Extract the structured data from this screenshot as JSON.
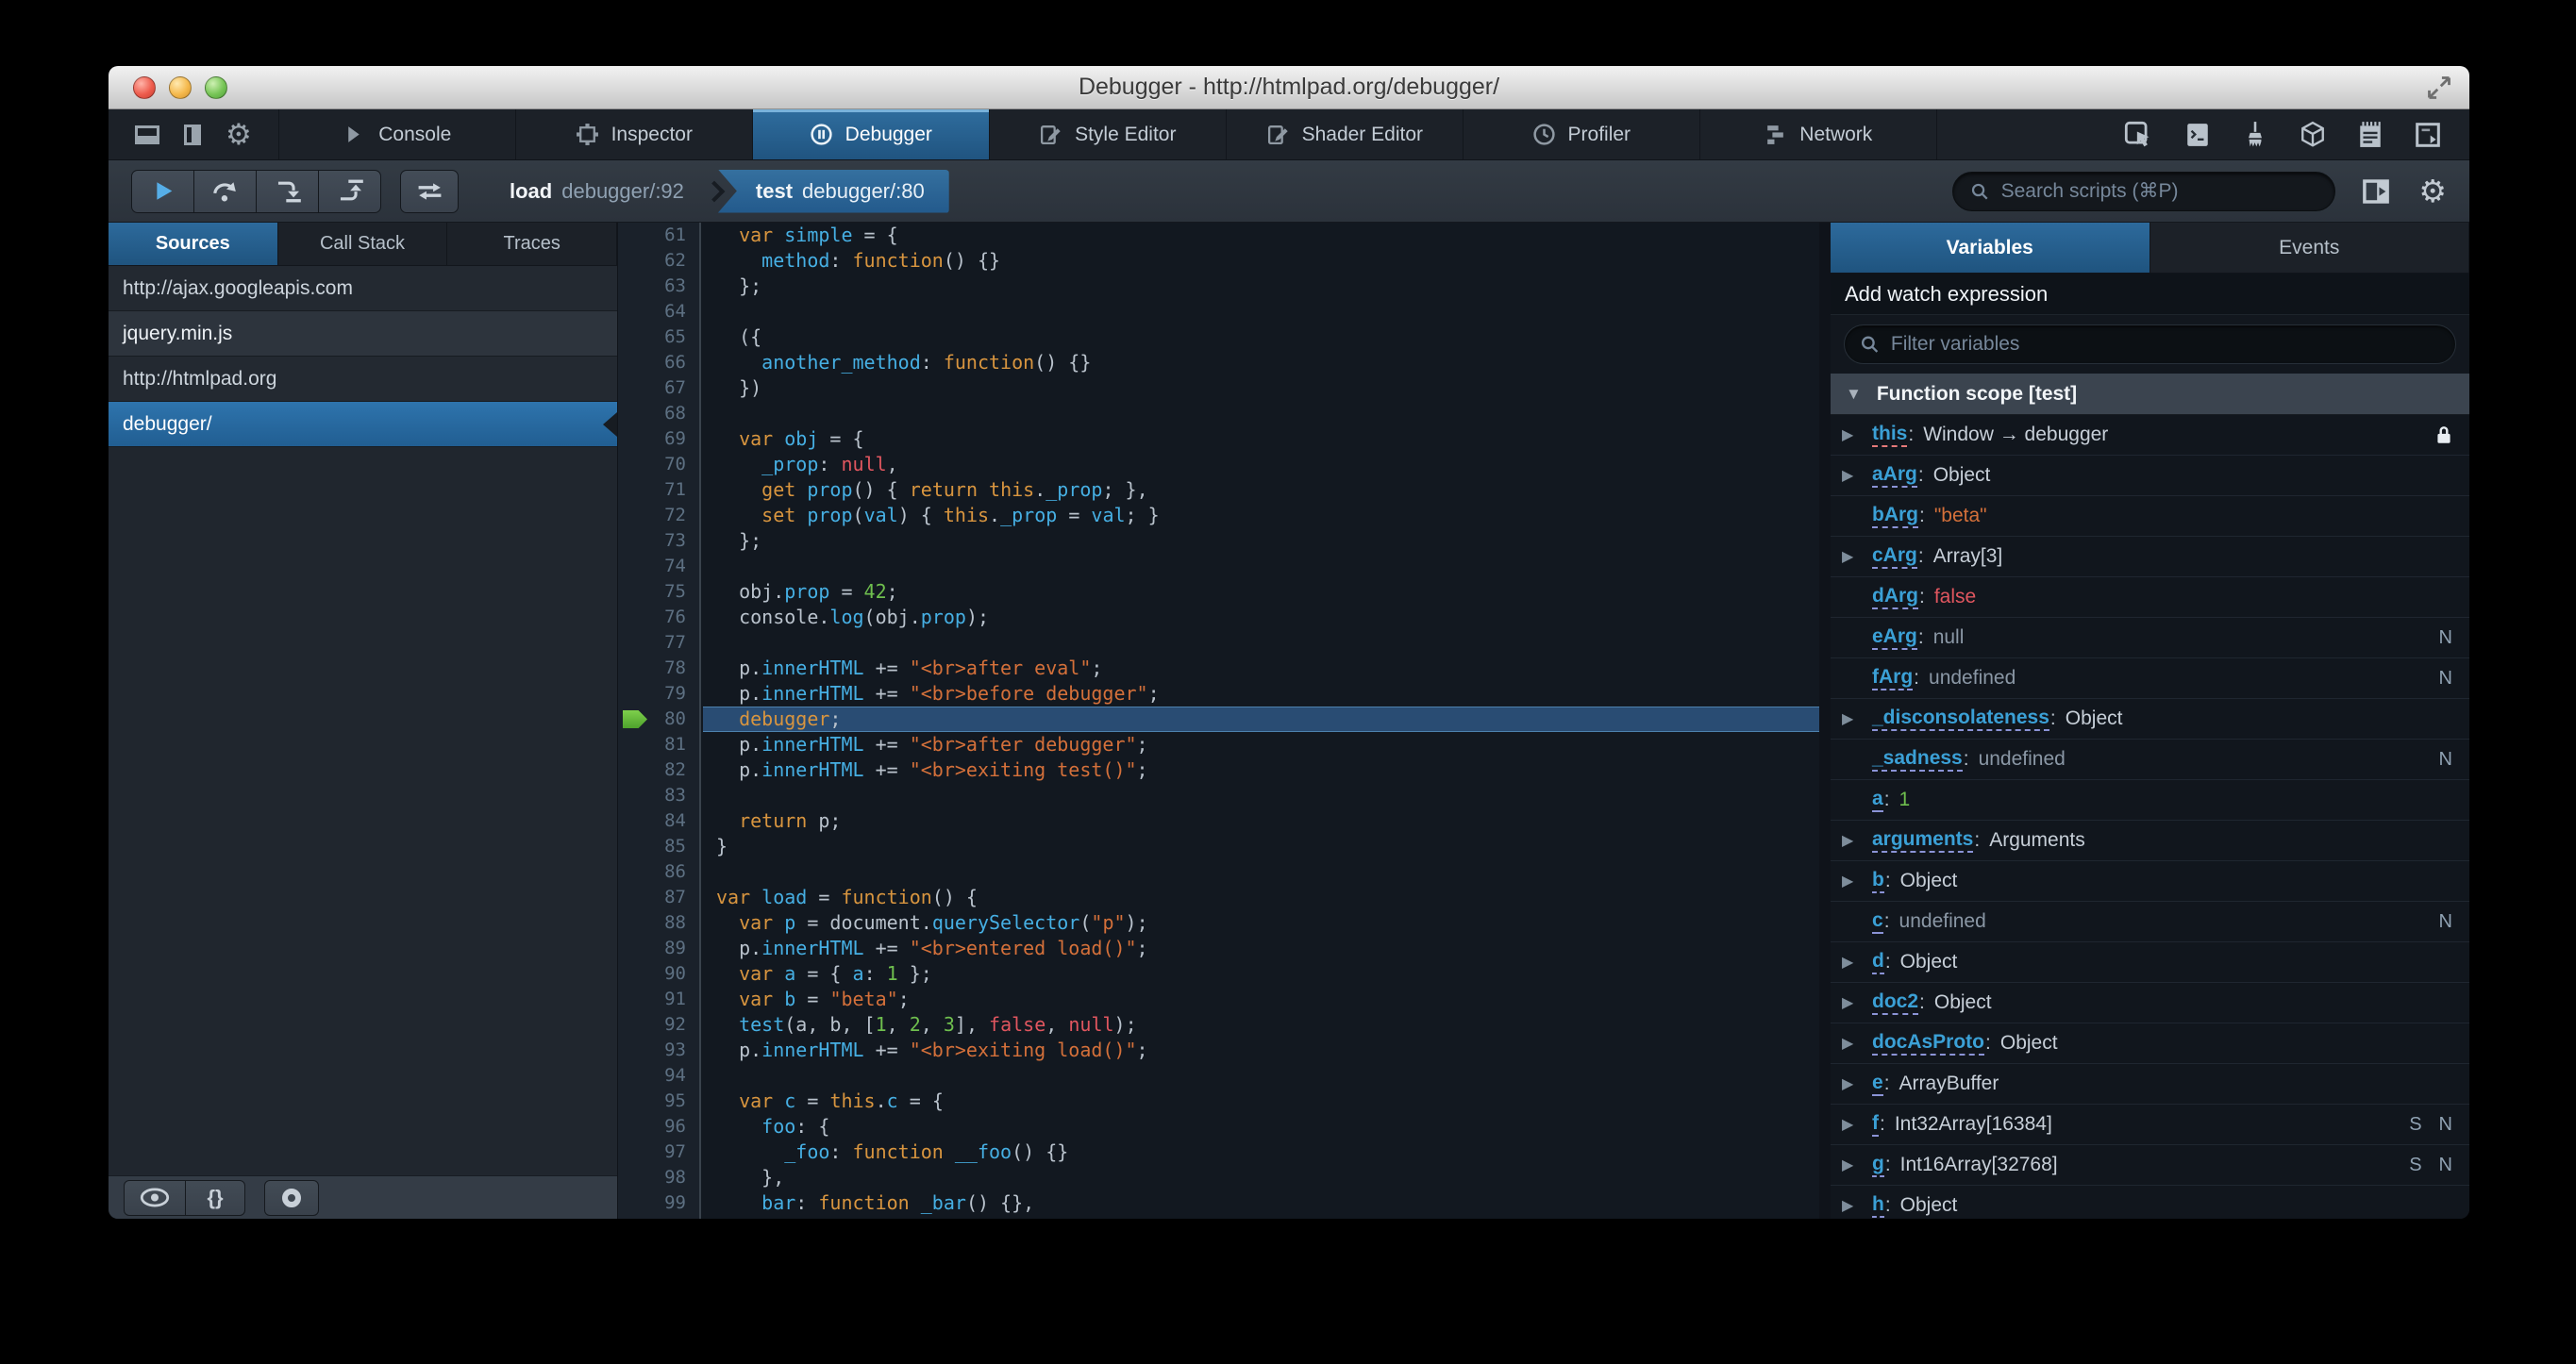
{
  "window": {
    "title": "Debugger - http://htmlpad.org/debugger/"
  },
  "tabbar": {
    "tabs": [
      {
        "label": "Console",
        "icon": "console",
        "active": false
      },
      {
        "label": "Inspector",
        "icon": "inspector",
        "active": false
      },
      {
        "label": "Debugger",
        "icon": "debugger",
        "active": true
      },
      {
        "label": "Style Editor",
        "icon": "style-editor",
        "active": false
      },
      {
        "label": "Shader Editor",
        "icon": "shader-editor",
        "active": false
      },
      {
        "label": "Profiler",
        "icon": "profiler",
        "active": false
      },
      {
        "label": "Network",
        "icon": "network",
        "active": false
      }
    ],
    "right_icons": [
      "pick-element",
      "console-panel",
      "paintbrush",
      "3d-view",
      "scratchpad",
      "responsive-mode"
    ]
  },
  "toolbar": {
    "breadcrumbs": [
      {
        "fn": "load",
        "loc": "debugger/:92",
        "active": false
      },
      {
        "fn": "test",
        "loc": "debugger/:80",
        "active": true
      }
    ],
    "search_placeholder": "Search scripts (⌘P)"
  },
  "sidebar": {
    "tabs": [
      {
        "label": "Sources",
        "active": true
      },
      {
        "label": "Call Stack",
        "active": false
      },
      {
        "label": "Traces",
        "active": false
      }
    ],
    "sources": [
      {
        "type": "group",
        "label": "http://ajax.googleapis.com",
        "selected": false
      },
      {
        "type": "item",
        "label": "jquery.min.js",
        "selected": false
      },
      {
        "type": "group",
        "label": "http://htmlpad.org",
        "selected": false
      },
      {
        "type": "item",
        "label": "debugger/",
        "selected": true
      }
    ]
  },
  "editor": {
    "current_line": 80,
    "lines": [
      {
        "n": 61,
        "t": [
          [
            "p",
            "  "
          ],
          [
            "k",
            "var"
          ],
          [
            "p",
            " "
          ],
          [
            "v",
            "simple"
          ],
          [
            "p",
            " = {"
          ]
        ]
      },
      {
        "n": 62,
        "t": [
          [
            "p",
            "    "
          ],
          [
            "v",
            "method"
          ],
          [
            "p",
            ": "
          ],
          [
            "k",
            "function"
          ],
          [
            "p",
            "() {}"
          ]
        ]
      },
      {
        "n": 63,
        "t": [
          [
            "p",
            "  };"
          ]
        ]
      },
      {
        "n": 64,
        "t": []
      },
      {
        "n": 65,
        "t": [
          [
            "p",
            "  ({"
          ]
        ]
      },
      {
        "n": 66,
        "t": [
          [
            "p",
            "    "
          ],
          [
            "v",
            "another_method"
          ],
          [
            "p",
            ": "
          ],
          [
            "k",
            "function"
          ],
          [
            "p",
            "() {}"
          ]
        ]
      },
      {
        "n": 67,
        "t": [
          [
            "p",
            "  })"
          ]
        ]
      },
      {
        "n": 68,
        "t": []
      },
      {
        "n": 69,
        "t": [
          [
            "p",
            "  "
          ],
          [
            "k",
            "var"
          ],
          [
            "p",
            " "
          ],
          [
            "v",
            "obj"
          ],
          [
            "p",
            " = {"
          ]
        ]
      },
      {
        "n": 70,
        "t": [
          [
            "p",
            "    "
          ],
          [
            "v",
            "_prop"
          ],
          [
            "p",
            ": "
          ],
          [
            "a",
            "null"
          ],
          [
            "p",
            ","
          ]
        ]
      },
      {
        "n": 71,
        "t": [
          [
            "p",
            "    "
          ],
          [
            "k",
            "get"
          ],
          [
            "p",
            " "
          ],
          [
            "v",
            "prop"
          ],
          [
            "p",
            "() { "
          ],
          [
            "k",
            "return"
          ],
          [
            "p",
            " "
          ],
          [
            "k",
            "this"
          ],
          [
            "p",
            "."
          ],
          [
            "v",
            "_prop"
          ],
          [
            "p",
            "; },"
          ]
        ]
      },
      {
        "n": 72,
        "t": [
          [
            "p",
            "    "
          ],
          [
            "k",
            "set"
          ],
          [
            "p",
            " "
          ],
          [
            "v",
            "prop"
          ],
          [
            "p",
            "("
          ],
          [
            "v",
            "val"
          ],
          [
            "p",
            ") { "
          ],
          [
            "k",
            "this"
          ],
          [
            "p",
            "."
          ],
          [
            "v",
            "_prop"
          ],
          [
            "p",
            " = "
          ],
          [
            "v",
            "val"
          ],
          [
            "p",
            "; }"
          ]
        ]
      },
      {
        "n": 73,
        "t": [
          [
            "p",
            "  };"
          ]
        ]
      },
      {
        "n": 74,
        "t": []
      },
      {
        "n": 75,
        "t": [
          [
            "p",
            "  obj."
          ],
          [
            "v",
            "prop"
          ],
          [
            "p",
            " = "
          ],
          [
            "n",
            "42"
          ],
          [
            "p",
            ";"
          ]
        ]
      },
      {
        "n": 76,
        "t": [
          [
            "p",
            "  console."
          ],
          [
            "v",
            "log"
          ],
          [
            "p",
            "(obj."
          ],
          [
            "v",
            "prop"
          ],
          [
            "p",
            ");"
          ]
        ]
      },
      {
        "n": 77,
        "t": []
      },
      {
        "n": 78,
        "t": [
          [
            "p",
            "  p."
          ],
          [
            "v",
            "innerHTML"
          ],
          [
            "p",
            " += "
          ],
          [
            "s",
            "\"<br>after eval\""
          ],
          [
            "p",
            ";"
          ]
        ]
      },
      {
        "n": 79,
        "t": [
          [
            "p",
            "  p."
          ],
          [
            "v",
            "innerHTML"
          ],
          [
            "p",
            " += "
          ],
          [
            "s",
            "\"<br>before debugger\""
          ],
          [
            "p",
            ";"
          ]
        ]
      },
      {
        "n": 80,
        "t": [
          [
            "p",
            "  "
          ],
          [
            "k",
            "debugger"
          ],
          [
            "p",
            ";"
          ]
        ]
      },
      {
        "n": 81,
        "t": [
          [
            "p",
            "  p."
          ],
          [
            "v",
            "innerHTML"
          ],
          [
            "p",
            " += "
          ],
          [
            "s",
            "\"<br>after debugger\""
          ],
          [
            "p",
            ";"
          ]
        ]
      },
      {
        "n": 82,
        "t": [
          [
            "p",
            "  p."
          ],
          [
            "v",
            "innerHTML"
          ],
          [
            "p",
            " += "
          ],
          [
            "s",
            "\"<br>exiting test()\""
          ],
          [
            "p",
            ";"
          ]
        ]
      },
      {
        "n": 83,
        "t": []
      },
      {
        "n": 84,
        "t": [
          [
            "p",
            "  "
          ],
          [
            "k",
            "return"
          ],
          [
            "p",
            " p;"
          ]
        ]
      },
      {
        "n": 85,
        "t": [
          [
            "p",
            "}"
          ]
        ]
      },
      {
        "n": 86,
        "t": []
      },
      {
        "n": 87,
        "t": [
          [
            "k",
            "var"
          ],
          [
            "p",
            " "
          ],
          [
            "v",
            "load"
          ],
          [
            "p",
            " = "
          ],
          [
            "k",
            "function"
          ],
          [
            "p",
            "() {"
          ]
        ]
      },
      {
        "n": 88,
        "t": [
          [
            "p",
            "  "
          ],
          [
            "k",
            "var"
          ],
          [
            "p",
            " "
          ],
          [
            "v",
            "p"
          ],
          [
            "p",
            " = document."
          ],
          [
            "v",
            "querySelector"
          ],
          [
            "p",
            "("
          ],
          [
            "s",
            "\"p\""
          ],
          [
            "p",
            ");"
          ]
        ]
      },
      {
        "n": 89,
        "t": [
          [
            "p",
            "  p."
          ],
          [
            "v",
            "innerHTML"
          ],
          [
            "p",
            " += "
          ],
          [
            "s",
            "\"<br>entered load()\""
          ],
          [
            "p",
            ";"
          ]
        ]
      },
      {
        "n": 90,
        "t": [
          [
            "p",
            "  "
          ],
          [
            "k",
            "var"
          ],
          [
            "p",
            " "
          ],
          [
            "v",
            "a"
          ],
          [
            "p",
            " = { "
          ],
          [
            "v",
            "a"
          ],
          [
            "p",
            ": "
          ],
          [
            "n",
            "1"
          ],
          [
            "p",
            " };"
          ]
        ]
      },
      {
        "n": 91,
        "t": [
          [
            "p",
            "  "
          ],
          [
            "k",
            "var"
          ],
          [
            "p",
            " "
          ],
          [
            "v",
            "b"
          ],
          [
            "p",
            " = "
          ],
          [
            "s",
            "\"beta\""
          ],
          [
            "p",
            ";"
          ]
        ]
      },
      {
        "n": 92,
        "t": [
          [
            "p",
            "  "
          ],
          [
            "v",
            "test"
          ],
          [
            "p",
            "(a, b, ["
          ],
          [
            "n",
            "1"
          ],
          [
            "p",
            ", "
          ],
          [
            "n",
            "2"
          ],
          [
            "p",
            ", "
          ],
          [
            "n",
            "3"
          ],
          [
            "p",
            "], "
          ],
          [
            "a",
            "false"
          ],
          [
            "p",
            ", "
          ],
          [
            "a",
            "null"
          ],
          [
            "p",
            ");"
          ]
        ]
      },
      {
        "n": 93,
        "t": [
          [
            "p",
            "  p."
          ],
          [
            "v",
            "innerHTML"
          ],
          [
            "p",
            " += "
          ],
          [
            "s",
            "\"<br>exiting load()\""
          ],
          [
            "p",
            ";"
          ]
        ]
      },
      {
        "n": 94,
        "t": []
      },
      {
        "n": 95,
        "t": [
          [
            "p",
            "  "
          ],
          [
            "k",
            "var"
          ],
          [
            "p",
            " "
          ],
          [
            "v",
            "c"
          ],
          [
            "p",
            " = "
          ],
          [
            "k",
            "this"
          ],
          [
            "p",
            "."
          ],
          [
            "v",
            "c"
          ],
          [
            "p",
            " = {"
          ]
        ]
      },
      {
        "n": 96,
        "t": [
          [
            "p",
            "    "
          ],
          [
            "v",
            "foo"
          ],
          [
            "p",
            ": {"
          ]
        ]
      },
      {
        "n": 97,
        "t": [
          [
            "p",
            "      "
          ],
          [
            "v",
            "_foo"
          ],
          [
            "p",
            ": "
          ],
          [
            "k",
            "function"
          ],
          [
            "p",
            " "
          ],
          [
            "v",
            "__foo"
          ],
          [
            "p",
            "() {}"
          ]
        ]
      },
      {
        "n": 98,
        "t": [
          [
            "p",
            "    },"
          ]
        ]
      },
      {
        "n": 99,
        "t": [
          [
            "p",
            "    "
          ],
          [
            "v",
            "bar"
          ],
          [
            "p",
            ": "
          ],
          [
            "k",
            "function"
          ],
          [
            "p",
            " "
          ],
          [
            "v",
            "_bar"
          ],
          [
            "p",
            "() {},"
          ]
        ]
      }
    ]
  },
  "variables": {
    "tabs": [
      {
        "label": "Variables",
        "active": true
      },
      {
        "label": "Events",
        "active": false
      }
    ],
    "watch_label": "Add watch expression",
    "filter_placeholder": "Filter variables",
    "scope": "Function scope [test]",
    "rows": [
      {
        "expand": true,
        "name": "this",
        "value": "Window → debugger",
        "vclass": "obj",
        "lock": true,
        "u": "pink"
      },
      {
        "expand": true,
        "name": "aArg",
        "value": "Object",
        "vclass": "obj"
      },
      {
        "expand": false,
        "name": "bArg",
        "value": "\"beta\"",
        "vclass": "str"
      },
      {
        "expand": true,
        "name": "cArg",
        "value": "Array[3]",
        "vclass": "obj"
      },
      {
        "expand": false,
        "name": "dArg",
        "value": "false",
        "vclass": "bool"
      },
      {
        "expand": false,
        "name": "eArg",
        "value": "null",
        "vclass": "undef",
        "badges": [
          "N"
        ]
      },
      {
        "expand": false,
        "name": "fArg",
        "value": "undefined",
        "vclass": "undef",
        "badges": [
          "N"
        ]
      },
      {
        "expand": true,
        "name": "_disconsolateness",
        "value": "Object",
        "vclass": "obj"
      },
      {
        "expand": false,
        "name": "_sadness",
        "value": "undefined",
        "vclass": "undef",
        "badges": [
          "N"
        ]
      },
      {
        "expand": false,
        "name": "a",
        "value": "1",
        "vclass": "num"
      },
      {
        "expand": true,
        "name": "arguments",
        "value": "Arguments",
        "vclass": "obj"
      },
      {
        "expand": true,
        "name": "b",
        "value": "Object",
        "vclass": "obj"
      },
      {
        "expand": false,
        "name": "c",
        "value": "undefined",
        "vclass": "undef",
        "badges": [
          "N"
        ]
      },
      {
        "expand": true,
        "name": "d",
        "value": "Object",
        "vclass": "obj"
      },
      {
        "expand": true,
        "name": "doc2",
        "value": "Object",
        "vclass": "obj"
      },
      {
        "expand": true,
        "name": "docAsProto",
        "value": "Object",
        "vclass": "obj"
      },
      {
        "expand": true,
        "name": "e",
        "value": "ArrayBuffer",
        "vclass": "obj"
      },
      {
        "expand": true,
        "name": "f",
        "value": "Int32Array[16384]",
        "vclass": "obj",
        "badges": [
          "S",
          "N"
        ]
      },
      {
        "expand": true,
        "name": "g",
        "value": "Int16Array[32768]",
        "vclass": "obj",
        "badges": [
          "S",
          "N"
        ]
      },
      {
        "expand": true,
        "name": "h",
        "value": "Object",
        "vclass": "obj"
      }
    ]
  },
  "colors": {
    "accent_blue": "#2d6a9b",
    "selection_blue": "#2a6ba5",
    "keyword": "#d8953f",
    "identifier": "#46afe3",
    "string": "#d4703a",
    "number": "#6fbf4e",
    "atom_red": "#e0565f",
    "current_line": "#294c73",
    "debug_arrow_green": "#6fce4e"
  }
}
